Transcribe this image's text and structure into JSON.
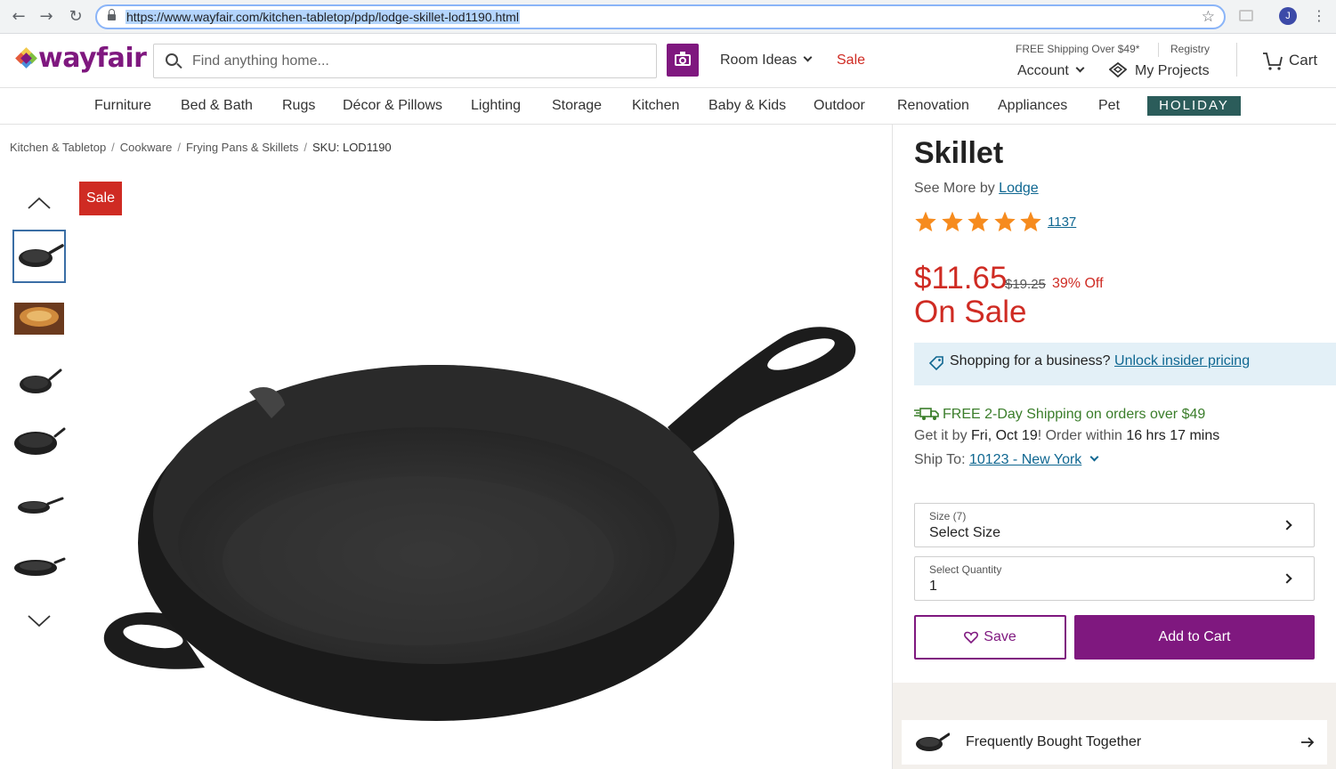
{
  "browser": {
    "url": "https://www.wayfair.com/kitchen-tabletop/pdp/lodge-skillet-lod1190.html",
    "profile_initial": "J"
  },
  "header": {
    "logo": "wayfair",
    "search_placeholder": "Find anything home...",
    "room_ideas": "Room Ideas",
    "sale": "Sale",
    "free_shipping": "FREE Shipping Over $49*",
    "registry": "Registry",
    "account": "Account",
    "my_projects": "My Projects",
    "cart": "Cart"
  },
  "categories": [
    "Furniture",
    "Bed & Bath",
    "Rugs",
    "Décor & Pillows",
    "Lighting",
    "Storage",
    "Kitchen",
    "Baby & Kids",
    "Outdoor",
    "Renovation",
    "Appliances",
    "Pet"
  ],
  "holiday": "HOLIDAY",
  "breadcrumb": [
    "Kitchen & Tabletop",
    "Cookware",
    "Frying Pans & Skillets",
    "SKU: LOD1190"
  ],
  "gallery": {
    "sale_badge": "Sale"
  },
  "product": {
    "title": "Skillet",
    "see_more_prefix": "See More by",
    "brand": "Lodge",
    "rating": 4.8,
    "review_count": "1137",
    "price": "$11.65",
    "old_price": "$19.25",
    "discount": "39% Off",
    "on_sale": "On Sale",
    "business_prompt": "Shopping for a business?",
    "business_link": "Unlock insider pricing",
    "shipping_line": "FREE 2-Day Shipping on orders over $49",
    "get_it_prefix": "Get it by",
    "delivery_date": "Fri, Oct 19",
    "order_within_prefix": "! Order within",
    "order_within": "16 hrs 17 mins",
    "ship_to_prefix": "Ship To:",
    "ship_to": "10123 - New York",
    "size_label": "Size (7)",
    "size_value": "Select Size",
    "qty_label": "Select Quantity",
    "qty_value": "1",
    "save": "Save",
    "add_to_cart": "Add to Cart",
    "frequently_bought": "Frequently Bought Together"
  },
  "colors": {
    "brand_purple": "#7f187f",
    "sale_red": "#cf2b23",
    "link_blue": "#0f6791",
    "shipping_green": "#3a7d2a",
    "holiday_teal": "#2b5c5a"
  }
}
